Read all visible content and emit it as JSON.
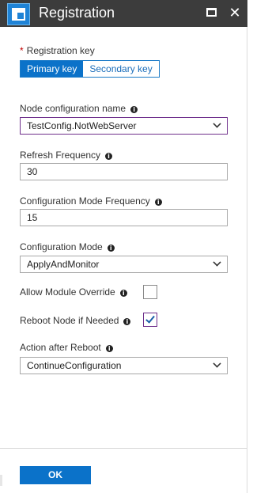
{
  "window": {
    "title": "Registration"
  },
  "registration_key": {
    "label": "Registration key",
    "primary_label": "Primary key",
    "secondary_label": "Secondary key"
  },
  "node_configuration": {
    "label": "Node configuration name",
    "value": "TestConfig.NotWebServer"
  },
  "refresh_frequency": {
    "label": "Refresh Frequency",
    "value": "30"
  },
  "config_mode_frequency": {
    "label": "Configuration Mode Frequency",
    "value": "15"
  },
  "configuration_mode": {
    "label": "Configuration Mode",
    "value": "ApplyAndMonitor"
  },
  "allow_module_override": {
    "label": "Allow Module Override",
    "checked": false
  },
  "reboot_node": {
    "label": "Reboot Node if Needed",
    "checked": true
  },
  "action_after_reboot": {
    "label": "Action after Reboot",
    "value": "ContinueConfiguration"
  },
  "footer": {
    "ok_label": "OK"
  },
  "colors": {
    "titlebar": "#3c3c3c",
    "accent": "#0b72c9",
    "focus": "#6e2f8b"
  }
}
